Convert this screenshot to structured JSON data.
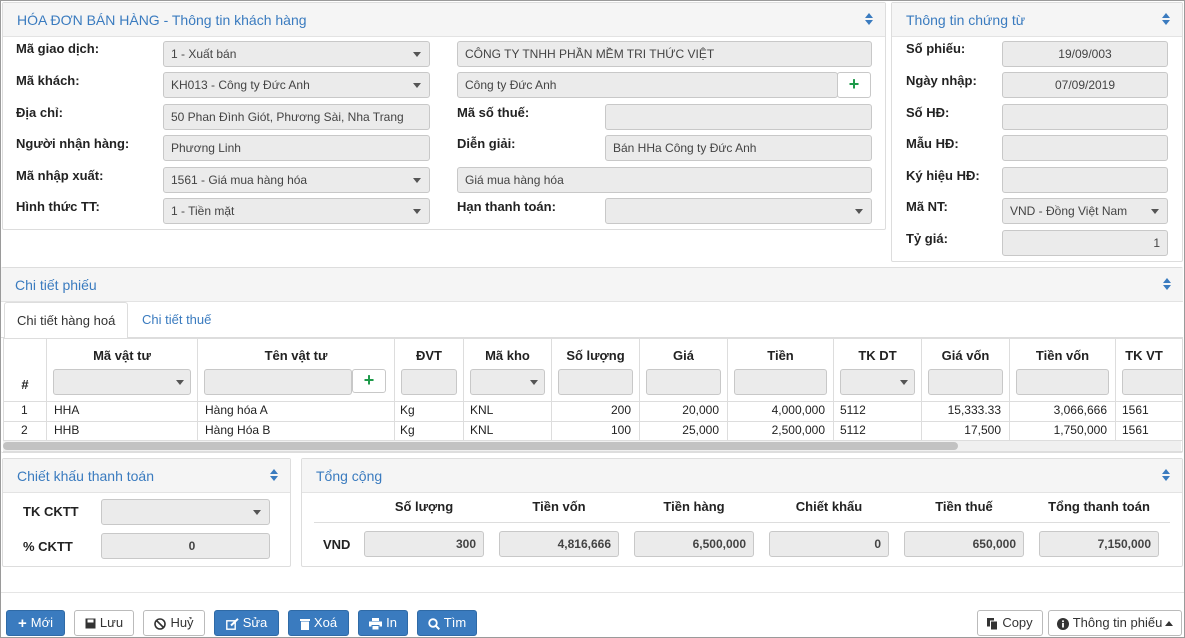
{
  "customer_panel": {
    "title": "HÓA ĐƠN BÁN HÀNG - Thông tin khách hàng",
    "transaction_code_label": "Mã giao dịch:",
    "transaction_code": "1 - Xuất bán",
    "company_name": "CÔNG TY TNHH PHẦN MỀM TRI THỨC VIỆT",
    "customer_code_label": "Mã khách:",
    "customer_code": "KH013 - Công ty Đức Anh",
    "customer_name": "Công ty Đức Anh",
    "address_label": "Địa chỉ:",
    "address": "50 Phan Đình Giót, Phương Sài, Nha Trang",
    "tax_code_label": "Mã số thuế:",
    "tax_code": "",
    "receiver_label": "Người nhận hàng:",
    "receiver": "Phương Linh",
    "description_label": "Diễn giải:",
    "description": "Bán HHa Công ty Đức Anh",
    "io_code_label": "Mã nhập xuất:",
    "io_code": "1561 - Giá mua hàng hóa",
    "io_code_name": "Giá mua hàng hóa",
    "payment_method_label": "Hình thức TT:",
    "payment_method": "1 - Tiền mặt",
    "due_date_label": "Hạn thanh toán:",
    "due_date": ""
  },
  "document_panel": {
    "title": "Thông tin chứng từ",
    "voucher_no_label": "Số phiếu:",
    "voucher_no": "19/09/003",
    "entry_date_label": "Ngày nhập:",
    "entry_date": "07/09/2019",
    "invoice_no_label": "Số HĐ:",
    "invoice_no": "",
    "invoice_form_label": "Mẫu HĐ:",
    "invoice_form": "",
    "invoice_symbol_label": "Ký hiệu HĐ:",
    "invoice_symbol": "",
    "currency_label": "Mã NT:",
    "currency": "VND - Đồng Việt Nam",
    "rate_label": "Tỷ giá:",
    "rate": "1"
  },
  "detail_panel": {
    "title": "Chi tiết phiếu",
    "tabs": [
      "Chi tiết hàng hoá",
      "Chi tiết thuế"
    ],
    "columns": [
      "#",
      "Mã vật tư",
      "Tên vật tư",
      "ĐVT",
      "Mã kho",
      "Số lượng",
      "Giá",
      "Tiền",
      "TK DT",
      "Giá vốn",
      "Tiền vốn",
      "TK VT"
    ],
    "rows": [
      {
        "no": "1",
        "code": "HHA",
        "name": "Hàng hóa A",
        "unit": "Kg",
        "warehouse": "KNL",
        "qty": "200",
        "price": "20,000",
        "amount": "4,000,000",
        "revenue_acc": "5112",
        "cost_price": "15,333.33",
        "cost_amount": "3,066,666",
        "stock_acc": "1561"
      },
      {
        "no": "2",
        "code": "HHB",
        "name": "Hàng Hóa B",
        "unit": "Kg",
        "warehouse": "KNL",
        "qty": "100",
        "price": "25,000",
        "amount": "2,500,000",
        "revenue_acc": "5112",
        "cost_price": "17,500",
        "cost_amount": "1,750,000",
        "stock_acc": "1561"
      }
    ]
  },
  "discount_panel": {
    "title": "Chiết khấu thanh toán",
    "account_label": "TK CKTT",
    "account": "",
    "percent_label": "% CKTT",
    "percent": "0"
  },
  "total_panel": {
    "title": "Tổng cộng",
    "headers": [
      "Số lượng",
      "Tiền vốn",
      "Tiền hàng",
      "Chiết khấu",
      "Tiền thuế",
      "Tổng thanh toán"
    ],
    "currency_label": "VND",
    "values": [
      "300",
      "4,816,666",
      "6,500,000",
      "0",
      "650,000",
      "7,150,000"
    ]
  },
  "toolbar": {
    "new": "Mới",
    "save": "Lưu",
    "cancel": "Huỷ",
    "edit": "Sửa",
    "delete": "Xoá",
    "print": "In",
    "search": "Tìm",
    "copy": "Copy",
    "voucher_info": "Thông tin phiếu"
  },
  "colors": {
    "accent": "#3a7bbf",
    "add_green": "#1e9a4a",
    "field_bg": "#ebebeb"
  },
  "icons": [
    "sort-icon",
    "plus-icon",
    "save-icon",
    "ban-icon",
    "edit-icon",
    "trash-icon",
    "print-icon",
    "search-icon",
    "copy-icon",
    "info-icon",
    "caret-up-icon"
  ]
}
